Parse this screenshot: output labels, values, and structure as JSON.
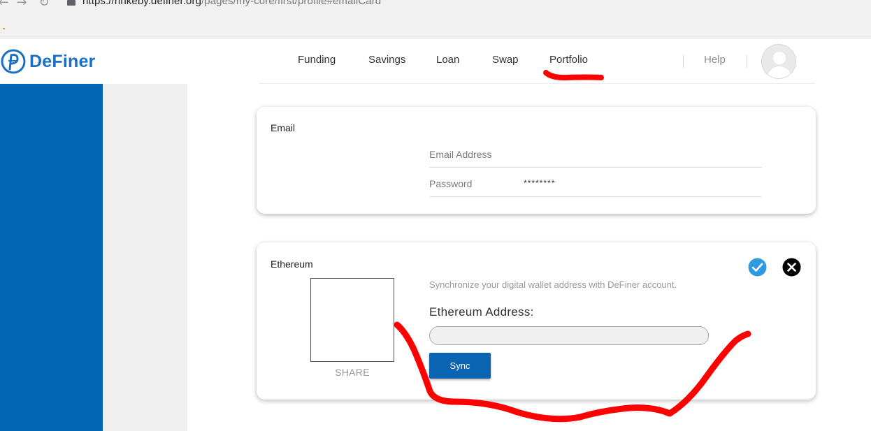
{
  "browser": {
    "url_host": "https://rinkeby.definer.org",
    "url_path": "/pages/my-core/first/profile#emailCard",
    "back_icon": "arrow-left-icon",
    "forward_icon": "arrow-right-icon",
    "reload_icon": "reload-icon",
    "lock_icon": "lock-icon"
  },
  "header": {
    "logo_text": "DeFiner",
    "nav": [
      {
        "label": "Funding"
      },
      {
        "label": "Savings"
      },
      {
        "label": "Loan"
      },
      {
        "label": "Swap"
      },
      {
        "label": "Portfolio"
      }
    ],
    "help_label": "Help",
    "avatar_icon": "user-avatar-icon"
  },
  "email_card": {
    "title": "Email",
    "email_label": "Email Address",
    "email_value": "",
    "password_label": "Password",
    "password_value": "********"
  },
  "ethereum_card": {
    "title": "Ethereum",
    "share_label": "SHARE",
    "sync_description": "Synchronize your digital wallet address with DeFiner account.",
    "address_label": "Ethereum Address:",
    "address_value": "",
    "sync_button": "Sync",
    "confirm_icon": "check-circle-icon",
    "close_icon": "close-circle-icon"
  },
  "colors": {
    "brand_blue": "#0066b3",
    "button_blue": "#0b64b1",
    "check_blue": "#2e9ae0",
    "annotation_red": "#ff0000"
  }
}
